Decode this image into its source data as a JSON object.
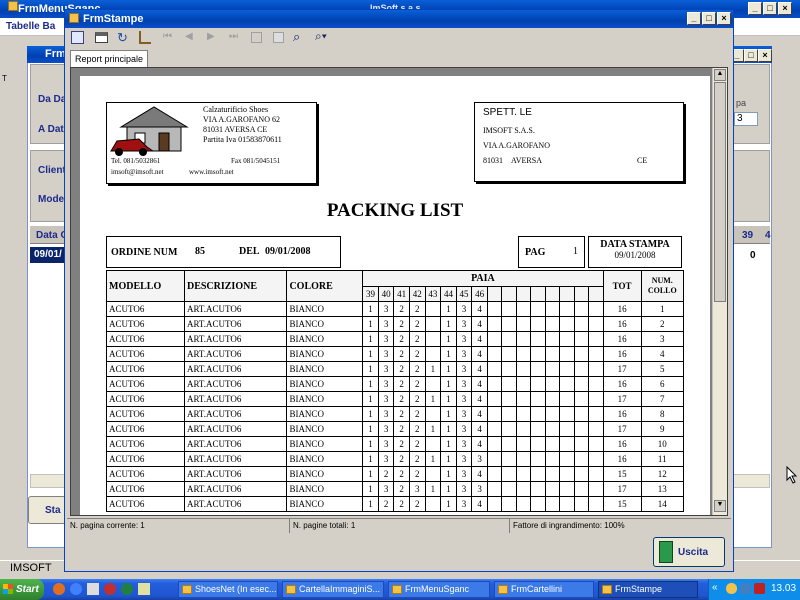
{
  "back_window": {
    "title": "FrmMenuSganc",
    "tab": "Tabelle Ba",
    "inner_title": "FrmC",
    "labels": {
      "da_data": "Da Da",
      "a_data": "A Dat",
      "cliente": "Cliente",
      "modello": "Model",
      "data_col": "Data O",
      "row_date": "09/01/",
      "spa": "pa",
      "num3": "3",
      "col39": "39",
      "col4": "4",
      "val0": "0",
      "imsoft": "IMSOFT",
      "start_btn": "Sta",
      "t_letter": "T"
    }
  },
  "top_center_title": "ImSoft s.a.s",
  "main_window": {
    "title": "FrmStampe",
    "tab": "Report principale",
    "status": {
      "current_page": "N. pagina corrente: 1",
      "total_pages": "N. pagine totali: 1",
      "zoom": "Fattore di ingrandimento: 100%"
    },
    "exit_button": "Uscita",
    "toolbar_icons": [
      "export-icon",
      "print-icon",
      "refresh-icon",
      "tree-icon",
      "first-page-icon",
      "prev-page-icon",
      "next-page-icon",
      "last-page-icon",
      "goto-page-icon",
      "stop-icon",
      "binoculars-icon",
      "zoom-icon"
    ]
  },
  "report": {
    "company": {
      "name": "Calzaturificio Shoes",
      "address": "VIA A.GAROFANO   62",
      "city": "81031   AVERSA        CE",
      "vat": "Partita Iva   01583870611",
      "tel": "Tel. 081/5032861",
      "fax": "Fax 081/5045151",
      "email": "imsoft@imsoft.net",
      "web": "www.imsoft.net"
    },
    "recipient": {
      "header": "SPETT. LE",
      "name": "IMSOFT S.A.S.",
      "address": "VIA A.GAROFANO",
      "cap": "81031",
      "city": "AVERSA",
      "prov": "CE"
    },
    "title": "PACKING LIST",
    "ordine_label": "ORDINE NUM",
    "ordine_num": "85",
    "del_label": "DEL",
    "del_date": "09/01/2008",
    "pag_label": "PAG",
    "pag_num": "1",
    "data_stampa_label": "DATA STAMPA",
    "data_stampa": "09/01/2008",
    "headers": {
      "modello": "MODELLO",
      "descrizione": "DESCRIZIONE",
      "colore": "COLORE",
      "paia": "PAIA",
      "tot": "TOT",
      "num": "NUM.",
      "collo": "COLLO"
    },
    "sizes": [
      "39",
      "40",
      "41",
      "42",
      "43",
      "44",
      "45",
      "46"
    ],
    "rows": [
      {
        "modello": "ACUTO6",
        "descr": "ART.ACUTO6",
        "colore": "BIANCO",
        "q": [
          "1",
          "3",
          "2",
          "2",
          "",
          "1",
          "3",
          "4"
        ],
        "tot": "16",
        "collo": "1"
      },
      {
        "modello": "ACUTO6",
        "descr": "ART.ACUTO6",
        "colore": "BIANCO",
        "q": [
          "1",
          "3",
          "2",
          "2",
          "",
          "1",
          "3",
          "4"
        ],
        "tot": "16",
        "collo": "2"
      },
      {
        "modello": "ACUTO6",
        "descr": "ART.ACUTO6",
        "colore": "BIANCO",
        "q": [
          "1",
          "3",
          "2",
          "2",
          "",
          "1",
          "3",
          "4"
        ],
        "tot": "16",
        "collo": "3"
      },
      {
        "modello": "ACUTO6",
        "descr": "ART.ACUTO6",
        "colore": "BIANCO",
        "q": [
          "1",
          "3",
          "2",
          "2",
          "",
          "1",
          "3",
          "4"
        ],
        "tot": "16",
        "collo": "4"
      },
      {
        "modello": "ACUTO6",
        "descr": "ART.ACUTO6",
        "colore": "BIANCO",
        "q": [
          "1",
          "3",
          "2",
          "2",
          "1",
          "1",
          "3",
          "4"
        ],
        "tot": "17",
        "collo": "5"
      },
      {
        "modello": "ACUTO6",
        "descr": "ART.ACUTO6",
        "colore": "BIANCO",
        "q": [
          "1",
          "3",
          "2",
          "2",
          "",
          "1",
          "3",
          "4"
        ],
        "tot": "16",
        "collo": "6"
      },
      {
        "modello": "ACUTO6",
        "descr": "ART.ACUTO6",
        "colore": "BIANCO",
        "q": [
          "1",
          "3",
          "2",
          "2",
          "1",
          "1",
          "3",
          "4"
        ],
        "tot": "17",
        "collo": "7"
      },
      {
        "modello": "ACUTO6",
        "descr": "ART.ACUTO6",
        "colore": "BIANCO",
        "q": [
          "1",
          "3",
          "2",
          "2",
          "",
          "1",
          "3",
          "4"
        ],
        "tot": "16",
        "collo": "8"
      },
      {
        "modello": "ACUTO6",
        "descr": "ART.ACUTO6",
        "colore": "BIANCO",
        "q": [
          "1",
          "3",
          "2",
          "2",
          "1",
          "1",
          "3",
          "4"
        ],
        "tot": "17",
        "collo": "9"
      },
      {
        "modello": "ACUTO6",
        "descr": "ART.ACUTO6",
        "colore": "BIANCO",
        "q": [
          "1",
          "3",
          "2",
          "2",
          "",
          "1",
          "3",
          "4"
        ],
        "tot": "16",
        "collo": "10"
      },
      {
        "modello": "ACUTO6",
        "descr": "ART.ACUTO6",
        "colore": "BIANCO",
        "q": [
          "1",
          "3",
          "2",
          "2",
          "1",
          "1",
          "3",
          "3"
        ],
        "tot": "16",
        "collo": "11"
      },
      {
        "modello": "ACUTO6",
        "descr": "ART.ACUTO6",
        "colore": "BIANCO",
        "q": [
          "1",
          "2",
          "2",
          "2",
          "",
          "1",
          "3",
          "4"
        ],
        "tot": "15",
        "collo": "12"
      },
      {
        "modello": "ACUTO6",
        "descr": "ART.ACUTO6",
        "colore": "BIANCO",
        "q": [
          "1",
          "3",
          "2",
          "3",
          "1",
          "1",
          "3",
          "3"
        ],
        "tot": "17",
        "collo": "13"
      },
      {
        "modello": "ACUTO6",
        "descr": "ART.ACUTO6",
        "colore": "BIANCO",
        "q": [
          "1",
          "2",
          "2",
          "2",
          "",
          "1",
          "3",
          "4"
        ],
        "tot": "15",
        "collo": "14"
      }
    ]
  },
  "taskbar": {
    "start": "Start",
    "items": [
      "ShoesNet (In esec...",
      "CartellaImmaginiS...",
      "FrmMenuSganc",
      "FrmCartellini",
      "FrmStampe"
    ],
    "clock": "13.03",
    "chevron": "«"
  },
  "colors": {
    "xp_blue": "#0a4ec8",
    "taskbar": "#245edb",
    "start_green": "#3c9a3c"
  }
}
